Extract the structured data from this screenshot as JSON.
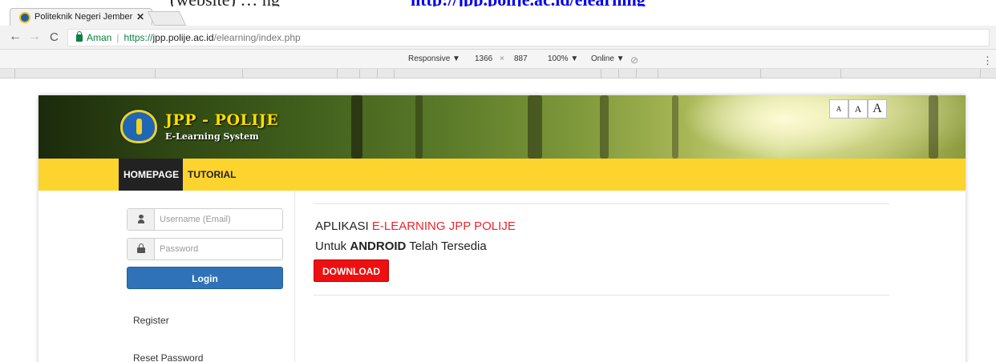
{
  "document": {
    "caption_text": "(website)            … ng",
    "caption_link": "http://jpp.polije.ac.id/elearning"
  },
  "browser": {
    "tab_title": "Politeknik Negeri Jember",
    "tab_close": "✕",
    "secure_label": "Aman",
    "url_protocol": "https://",
    "url_host": "jpp.polije.ac.id",
    "url_path": "/elearning/index.php",
    "nav_back": "←",
    "nav_forward": "→",
    "nav_reload": "C"
  },
  "devtools": {
    "mode": "Responsive ▼",
    "width": "1366",
    "times": "×",
    "height": "887",
    "zoom": "100% ▼",
    "network": "Online ▼",
    "rotate": "⃠",
    "menu": "⋮"
  },
  "site": {
    "logo_title": "JPP - POLIJE",
    "logo_subtitle": "E-Learning System",
    "font_size_buttons": [
      "A",
      "A",
      "A"
    ],
    "nav": {
      "home": "HOMEPAGE",
      "tutorial": "TUTORIAL"
    },
    "login": {
      "username_placeholder": "Username (Email)",
      "password_placeholder": "Password",
      "login_label": "Login",
      "register_label": "Register",
      "reset_label": "Reset Password"
    },
    "content": {
      "app_prefix": "APLIKASI ",
      "app_name": "E-LEARNING JPP POLIJE",
      "sub_prefix": "Untuk ",
      "sub_bold": "ANDROID",
      "sub_suffix": " Telah Tersedia",
      "download_label": "DOWNLOAD"
    }
  },
  "colors": {
    "nav_yellow": "#fcd42d",
    "home_active_bg": "#222222",
    "login_blue": "#2f72b8",
    "download_red": "#ee1010",
    "accent_red_text": "#e8272b",
    "secure_green": "#0b8043"
  }
}
